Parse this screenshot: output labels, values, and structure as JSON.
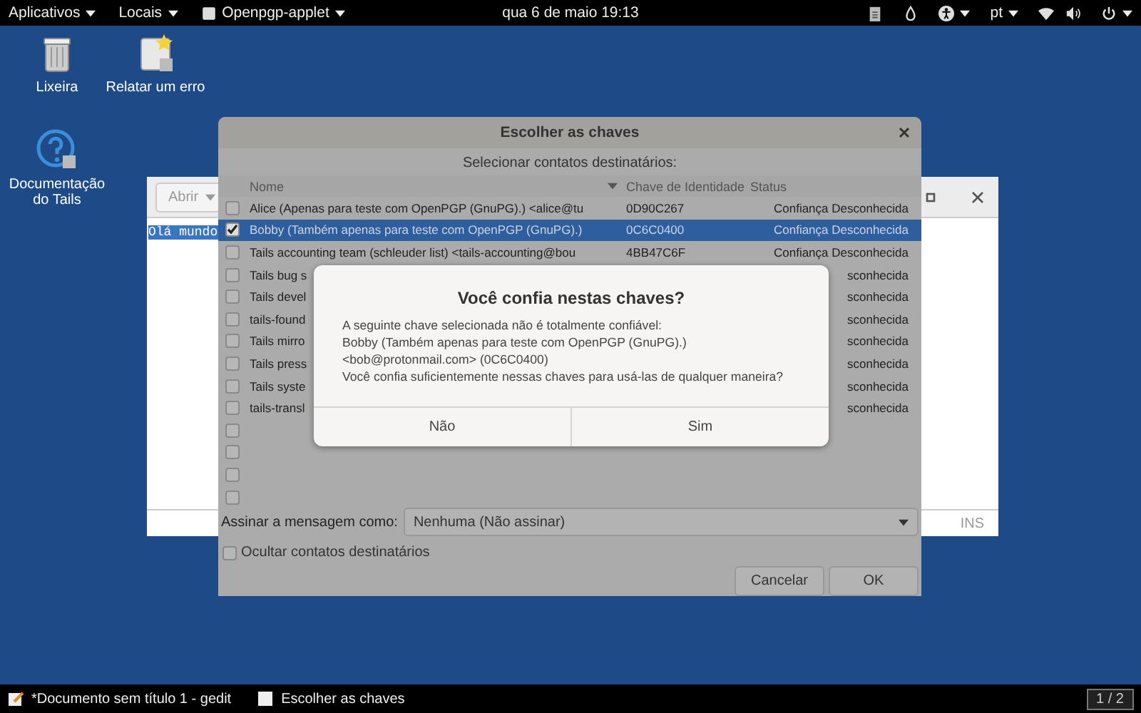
{
  "top_bar": {
    "menus": [
      "Aplicativos",
      "Locais",
      "Openpgp-applet"
    ],
    "clock": "qua 6 de maio  19:13",
    "language": "pt"
  },
  "desktop_icons": [
    {
      "label": "Lixeira",
      "kind": "trash"
    },
    {
      "label": "Relatar um erro",
      "kind": "report"
    },
    {
      "label": "Documentação do Tails",
      "kind": "help"
    }
  ],
  "editor_window": {
    "open_button": "Abrir",
    "text": "Olá mundo",
    "status": "INS"
  },
  "key_dialog": {
    "title": "Escolher as chaves",
    "prompt": "Selecionar contatos destinatários:",
    "columns": [
      "Nome",
      "Chave de Identidade",
      "Status"
    ],
    "rows": [
      {
        "name": "Alice (Apenas para teste com OpenPGP (GnuPG).) <alice@tu",
        "key": "0D90C267",
        "status": "Confiança Desconhecida",
        "checked": false,
        "selected": false
      },
      {
        "name": "Bobby (Também apenas para teste com OpenPGP (GnuPG).)",
        "key": "0C6C0400",
        "status": "Confiança Desconhecida",
        "checked": true,
        "selected": true
      },
      {
        "name": "Tails accounting team (schleuder list) <tails-accounting@bou",
        "key": "4BB47C6F",
        "status": "Confiança Desconhecida",
        "checked": false,
        "selected": false
      },
      {
        "name": "Tails bug s",
        "status": "sconhecida",
        "checked": false,
        "selected": false
      },
      {
        "name": "Tails devel",
        "status": "sconhecida",
        "checked": false,
        "selected": false
      },
      {
        "name": "tails-found",
        "status": "sconhecida",
        "checked": false,
        "selected": false
      },
      {
        "name": "Tails mirro",
        "status": "sconhecida",
        "checked": false,
        "selected": false
      },
      {
        "name": "Tails press",
        "status": "sconhecida",
        "checked": false,
        "selected": false
      },
      {
        "name": "Tails syste",
        "status": "sconhecida",
        "checked": false,
        "selected": false
      },
      {
        "name": "tails-transl",
        "status": "sconhecida",
        "checked": false,
        "selected": false
      },
      {
        "checked": false,
        "selected": false
      },
      {
        "checked": false,
        "selected": false
      },
      {
        "checked": false,
        "selected": false
      },
      {
        "checked": false,
        "selected": false
      }
    ],
    "sign_label": "Assinar a mensagem como:",
    "sign_value": "Nenhuma (Não assinar)",
    "hide_recipients": {
      "label": "Ocultar contatos destinatários",
      "checked": false
    },
    "buttons": [
      "Cancelar",
      "OK"
    ]
  },
  "confirm_dialog": {
    "title": "Você confia nestas chaves?",
    "message": "A seguinte chave selecionada não é totalmente confiável:\nBobby (Também apenas para teste com OpenPGP (GnuPG).)\n<bob@protonmail.com> (0C6C0400)\nVocê confia suficientemente nessas chaves para usá-las de qualquer maneira?",
    "buttons": [
      "Não",
      "Sim"
    ]
  },
  "taskbar": {
    "windows": [
      {
        "label": "*Documento sem título 1 - gedit",
        "kind": "editor"
      },
      {
        "label": "Escolher as chaves",
        "kind": "window"
      }
    ],
    "workspace": "1 / 2"
  }
}
